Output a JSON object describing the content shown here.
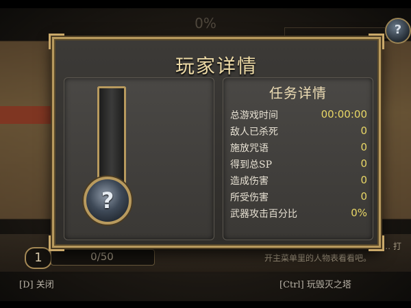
{
  "background": {
    "loading_percent": "0%",
    "hud": {
      "level": "1",
      "xp": "0/50",
      "tip_line1": "…… 打",
      "tip_line2": "开主菜单里的人物表看看吧。"
    }
  },
  "controls": {
    "close_hint": "[D] 关闭",
    "play_hint": "[Ctrl] 玩毁灭之塔",
    "help_icon": "?"
  },
  "dialog": {
    "title": "玩家详情",
    "gauge": {
      "icon": "question-mark",
      "symbol": "?",
      "fill_fraction": 0
    },
    "stats": {
      "title": "任务详情",
      "rows": [
        {
          "label": "总游戏时间",
          "value": "00:00:00"
        },
        {
          "label": "敌人已杀死",
          "value": "0"
        },
        {
          "label": "施放咒语",
          "value": "0"
        },
        {
          "label": "得到总SP",
          "value": "0"
        },
        {
          "label": "造成伤害",
          "value": "0"
        },
        {
          "label": "所受伤害",
          "value": "0"
        },
        {
          "label": "武器攻击百分比",
          "value": "0%"
        }
      ]
    }
  },
  "colors": {
    "frame_gold": "#b89a5e",
    "stat_value_yellow": "#e9d766",
    "title_text": "#ecd9a5"
  }
}
